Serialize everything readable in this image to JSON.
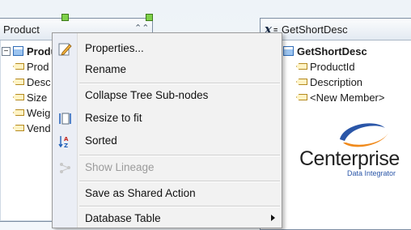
{
  "left_node": {
    "title": "Product",
    "root_label": "Product",
    "fields": [
      "Prod",
      "Desc",
      "Size",
      "Weig",
      "Vend"
    ]
  },
  "right_node": {
    "title": "GetShortDesc",
    "root_label": "GetShortDesc",
    "fields": [
      "ProductId",
      "Description",
      "<New Member>"
    ]
  },
  "logo": {
    "word": "Centerprise",
    "subtitle": "Data Integrator"
  },
  "context_menu": {
    "items": [
      {
        "label": "Properties...",
        "icon": "properties-pencil-icon",
        "enabled": true
      },
      {
        "label": "Rename",
        "icon": null,
        "enabled": true
      },
      {
        "label": "Collapse Tree Sub-nodes",
        "icon": null,
        "enabled": true
      },
      {
        "label": "Resize to fit",
        "icon": "resize-to-fit-icon",
        "enabled": true
      },
      {
        "label": "Sorted",
        "icon": "sort-az-icon",
        "enabled": true
      },
      {
        "label": "Show Lineage",
        "icon": "lineage-icon",
        "enabled": false
      },
      {
        "label": "Save as Shared Action",
        "icon": null,
        "enabled": true
      },
      {
        "label": "Database Table",
        "icon": null,
        "enabled": true,
        "has_submenu": true
      }
    ]
  },
  "colors": {
    "selection_handle": "#7fd14a",
    "logo_blue": "#2a56a8",
    "logo_orange": "#f08a1c"
  }
}
